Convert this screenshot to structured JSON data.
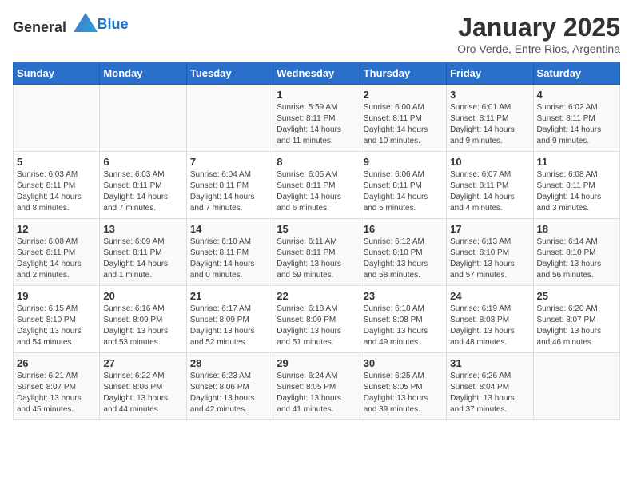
{
  "header": {
    "logo_general": "General",
    "logo_blue": "Blue",
    "title": "January 2025",
    "subtitle": "Oro Verde, Entre Rios, Argentina"
  },
  "days_of_week": [
    "Sunday",
    "Monday",
    "Tuesday",
    "Wednesday",
    "Thursday",
    "Friday",
    "Saturday"
  ],
  "weeks": [
    [
      {
        "day": "",
        "info": ""
      },
      {
        "day": "",
        "info": ""
      },
      {
        "day": "",
        "info": ""
      },
      {
        "day": "1",
        "info": "Sunrise: 5:59 AM\nSunset: 8:11 PM\nDaylight: 14 hours and 11 minutes."
      },
      {
        "day": "2",
        "info": "Sunrise: 6:00 AM\nSunset: 8:11 PM\nDaylight: 14 hours and 10 minutes."
      },
      {
        "day": "3",
        "info": "Sunrise: 6:01 AM\nSunset: 8:11 PM\nDaylight: 14 hours and 9 minutes."
      },
      {
        "day": "4",
        "info": "Sunrise: 6:02 AM\nSunset: 8:11 PM\nDaylight: 14 hours and 9 minutes."
      }
    ],
    [
      {
        "day": "5",
        "info": "Sunrise: 6:03 AM\nSunset: 8:11 PM\nDaylight: 14 hours and 8 minutes."
      },
      {
        "day": "6",
        "info": "Sunrise: 6:03 AM\nSunset: 8:11 PM\nDaylight: 14 hours and 7 minutes."
      },
      {
        "day": "7",
        "info": "Sunrise: 6:04 AM\nSunset: 8:11 PM\nDaylight: 14 hours and 7 minutes."
      },
      {
        "day": "8",
        "info": "Sunrise: 6:05 AM\nSunset: 8:11 PM\nDaylight: 14 hours and 6 minutes."
      },
      {
        "day": "9",
        "info": "Sunrise: 6:06 AM\nSunset: 8:11 PM\nDaylight: 14 hours and 5 minutes."
      },
      {
        "day": "10",
        "info": "Sunrise: 6:07 AM\nSunset: 8:11 PM\nDaylight: 14 hours and 4 minutes."
      },
      {
        "day": "11",
        "info": "Sunrise: 6:08 AM\nSunset: 8:11 PM\nDaylight: 14 hours and 3 minutes."
      }
    ],
    [
      {
        "day": "12",
        "info": "Sunrise: 6:08 AM\nSunset: 8:11 PM\nDaylight: 14 hours and 2 minutes."
      },
      {
        "day": "13",
        "info": "Sunrise: 6:09 AM\nSunset: 8:11 PM\nDaylight: 14 hours and 1 minute."
      },
      {
        "day": "14",
        "info": "Sunrise: 6:10 AM\nSunset: 8:11 PM\nDaylight: 14 hours and 0 minutes."
      },
      {
        "day": "15",
        "info": "Sunrise: 6:11 AM\nSunset: 8:11 PM\nDaylight: 13 hours and 59 minutes."
      },
      {
        "day": "16",
        "info": "Sunrise: 6:12 AM\nSunset: 8:10 PM\nDaylight: 13 hours and 58 minutes."
      },
      {
        "day": "17",
        "info": "Sunrise: 6:13 AM\nSunset: 8:10 PM\nDaylight: 13 hours and 57 minutes."
      },
      {
        "day": "18",
        "info": "Sunrise: 6:14 AM\nSunset: 8:10 PM\nDaylight: 13 hours and 56 minutes."
      }
    ],
    [
      {
        "day": "19",
        "info": "Sunrise: 6:15 AM\nSunset: 8:10 PM\nDaylight: 13 hours and 54 minutes."
      },
      {
        "day": "20",
        "info": "Sunrise: 6:16 AM\nSunset: 8:09 PM\nDaylight: 13 hours and 53 minutes."
      },
      {
        "day": "21",
        "info": "Sunrise: 6:17 AM\nSunset: 8:09 PM\nDaylight: 13 hours and 52 minutes."
      },
      {
        "day": "22",
        "info": "Sunrise: 6:18 AM\nSunset: 8:09 PM\nDaylight: 13 hours and 51 minutes."
      },
      {
        "day": "23",
        "info": "Sunrise: 6:18 AM\nSunset: 8:08 PM\nDaylight: 13 hours and 49 minutes."
      },
      {
        "day": "24",
        "info": "Sunrise: 6:19 AM\nSunset: 8:08 PM\nDaylight: 13 hours and 48 minutes."
      },
      {
        "day": "25",
        "info": "Sunrise: 6:20 AM\nSunset: 8:07 PM\nDaylight: 13 hours and 46 minutes."
      }
    ],
    [
      {
        "day": "26",
        "info": "Sunrise: 6:21 AM\nSunset: 8:07 PM\nDaylight: 13 hours and 45 minutes."
      },
      {
        "day": "27",
        "info": "Sunrise: 6:22 AM\nSunset: 8:06 PM\nDaylight: 13 hours and 44 minutes."
      },
      {
        "day": "28",
        "info": "Sunrise: 6:23 AM\nSunset: 8:06 PM\nDaylight: 13 hours and 42 minutes."
      },
      {
        "day": "29",
        "info": "Sunrise: 6:24 AM\nSunset: 8:05 PM\nDaylight: 13 hours and 41 minutes."
      },
      {
        "day": "30",
        "info": "Sunrise: 6:25 AM\nSunset: 8:05 PM\nDaylight: 13 hours and 39 minutes."
      },
      {
        "day": "31",
        "info": "Sunrise: 6:26 AM\nSunset: 8:04 PM\nDaylight: 13 hours and 37 minutes."
      },
      {
        "day": "",
        "info": ""
      }
    ]
  ]
}
